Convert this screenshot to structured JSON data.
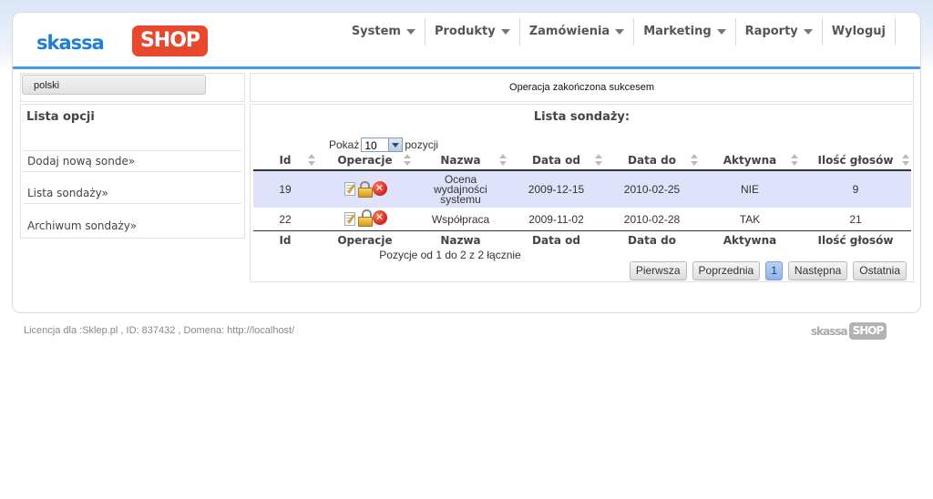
{
  "logo": {
    "part1": "skassa",
    "part2": "SHOP"
  },
  "nav": [
    {
      "label": "System",
      "has_dropdown": true
    },
    {
      "label": "Produkty",
      "has_dropdown": true
    },
    {
      "label": "Zamówienia",
      "has_dropdown": true
    },
    {
      "label": "Marketing",
      "has_dropdown": true
    },
    {
      "label": "Raporty",
      "has_dropdown": true
    },
    {
      "label": "Wyloguj",
      "has_dropdown": false
    }
  ],
  "language": {
    "selected": "polski"
  },
  "options": {
    "title": "Lista opcji",
    "items": [
      {
        "label": "Dodaj nową sonde»"
      },
      {
        "label": "Lista sondaży»"
      },
      {
        "label": "Archiwum sondaży»"
      }
    ]
  },
  "message": "Operacja zakończona sukcesem",
  "list": {
    "title": "Lista sondaży:",
    "show_label": "Pokaż",
    "show_value": "10",
    "show_suffix": "pozycji",
    "columns": [
      "Id",
      "Operacje",
      "Nazwa",
      "Data od",
      "Data do",
      "Aktywna",
      "Ilość głosów"
    ],
    "rows": [
      {
        "id": "19",
        "name": "Ocena wydajności systemu",
        "name_lines": [
          "Ocena",
          "wydajności",
          "systemu"
        ],
        "date_from": "2009-12-15",
        "date_to": "2010-02-25",
        "active": "NIE",
        "votes": "9",
        "lock": "closed"
      },
      {
        "id": "22",
        "name": "Współpraca",
        "name_lines": [
          "Współpraca"
        ],
        "date_from": "2009-11-02",
        "date_to": "2010-02-28",
        "active": "TAK",
        "votes": "21",
        "lock": "open"
      }
    ],
    "summary": "Pozycje od 1 do 2 z 2 łącznie",
    "pager": {
      "first": "Pierwsza",
      "prev": "Poprzednia",
      "current": "1",
      "next": "Następna",
      "last": "Ostatnia"
    }
  },
  "footer": {
    "license": "Licencja dla :Sklep.pl , ID: 837432 , Domena: http://localhost/",
    "logo_part1": "skassa",
    "logo_part2": "SHOP"
  },
  "colors": {
    "accent": "#4a9be5",
    "logo_red": "#e8482e",
    "logo_blue": "#1f7fd4",
    "row_highlight": "#dfe2fb"
  }
}
